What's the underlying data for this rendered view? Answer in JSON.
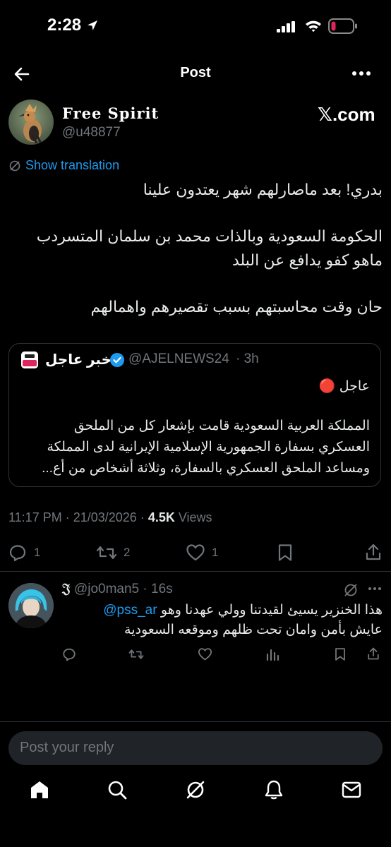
{
  "status_bar": {
    "time": "2:28"
  },
  "nav": {
    "title": "Post"
  },
  "post": {
    "author_name": "Free Spirit",
    "author_handle": "@u48877",
    "source_label": "𝕏.com",
    "show_translation": "Show translation",
    "lines": [
      "بدري! بعد ماصارلهم شهر يعتدون علينا",
      "الحكومة السعودية وبالذات محمد بن سلمان المتسردب",
      "ماهو كفو يدافع عن البلد",
      "حان وقت محاسبتهم بسبب تقصيرهم واهمالهم"
    ],
    "timestamp": "11:17 PM · 21/03/2026 ·",
    "views_count": "4.5K",
    "views_label": "Views",
    "stats": {
      "replies": "1",
      "reposts": "2",
      "likes": "1"
    }
  },
  "quote": {
    "name": "خبر عاجل",
    "handle": "@AJELNEWS24",
    "time": "· 3h",
    "logo_text": "خبر عاجل",
    "lines": [
      "عاجل 🔴",
      "المملكة العربية السعودية قامت بإشعار كل من الملحق",
      "العسكري بسفارة الجمهورية الإسلامية الإيرانية لدى المملكة",
      "ومساعد الملحق العسكري بالسفارة، وثلاثة أشخاص من أع..."
    ]
  },
  "reply": {
    "author_glyph": "𝔍",
    "handle": "@jo0man5",
    "time": "· 16s",
    "mention": "@pss_ar",
    "line1": "هذا الخنزير يسيئ لقيدتنا وولي عهدنا وهو",
    "line2": "عايش بأمن وامان تحت ظلهم وموقعه السعودية"
  },
  "composer": {
    "placeholder": "Post your reply"
  },
  "colors": {
    "accent": "#1d9bf0",
    "background": "#000000",
    "muted": "#71767b",
    "battery_low": "#e0245e"
  }
}
